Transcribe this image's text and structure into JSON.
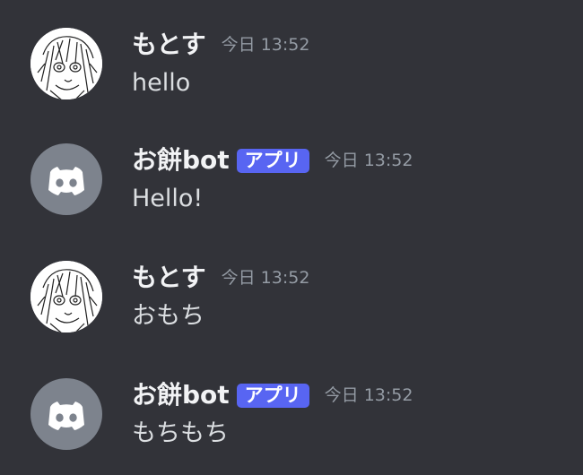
{
  "messages": [
    {
      "author": "もとす",
      "author_type": "user",
      "avatar_icon": "anime-sketch-avatar-icon",
      "timestamp": "今日 13:52",
      "content": "hello"
    },
    {
      "author": "お餅bot",
      "author_type": "bot",
      "tag": "アプリ",
      "avatar_icon": "discord-logo-icon",
      "timestamp": "今日 13:52",
      "content": "Hello!"
    },
    {
      "author": "もとす",
      "author_type": "user",
      "avatar_icon": "anime-sketch-avatar-icon",
      "timestamp": "今日 13:52",
      "content": "おもち"
    },
    {
      "author": "お餅bot",
      "author_type": "bot",
      "tag": "アプリ",
      "avatar_icon": "discord-logo-icon",
      "timestamp": "今日 13:52",
      "content": "もちもち"
    }
  ],
  "colors": {
    "background": "#323339",
    "username": "#f2f3f5",
    "timestamp": "#949ba4",
    "message_text": "#dbdee1",
    "app_tag": "#5865f2",
    "bot_avatar": "#7d838d"
  }
}
